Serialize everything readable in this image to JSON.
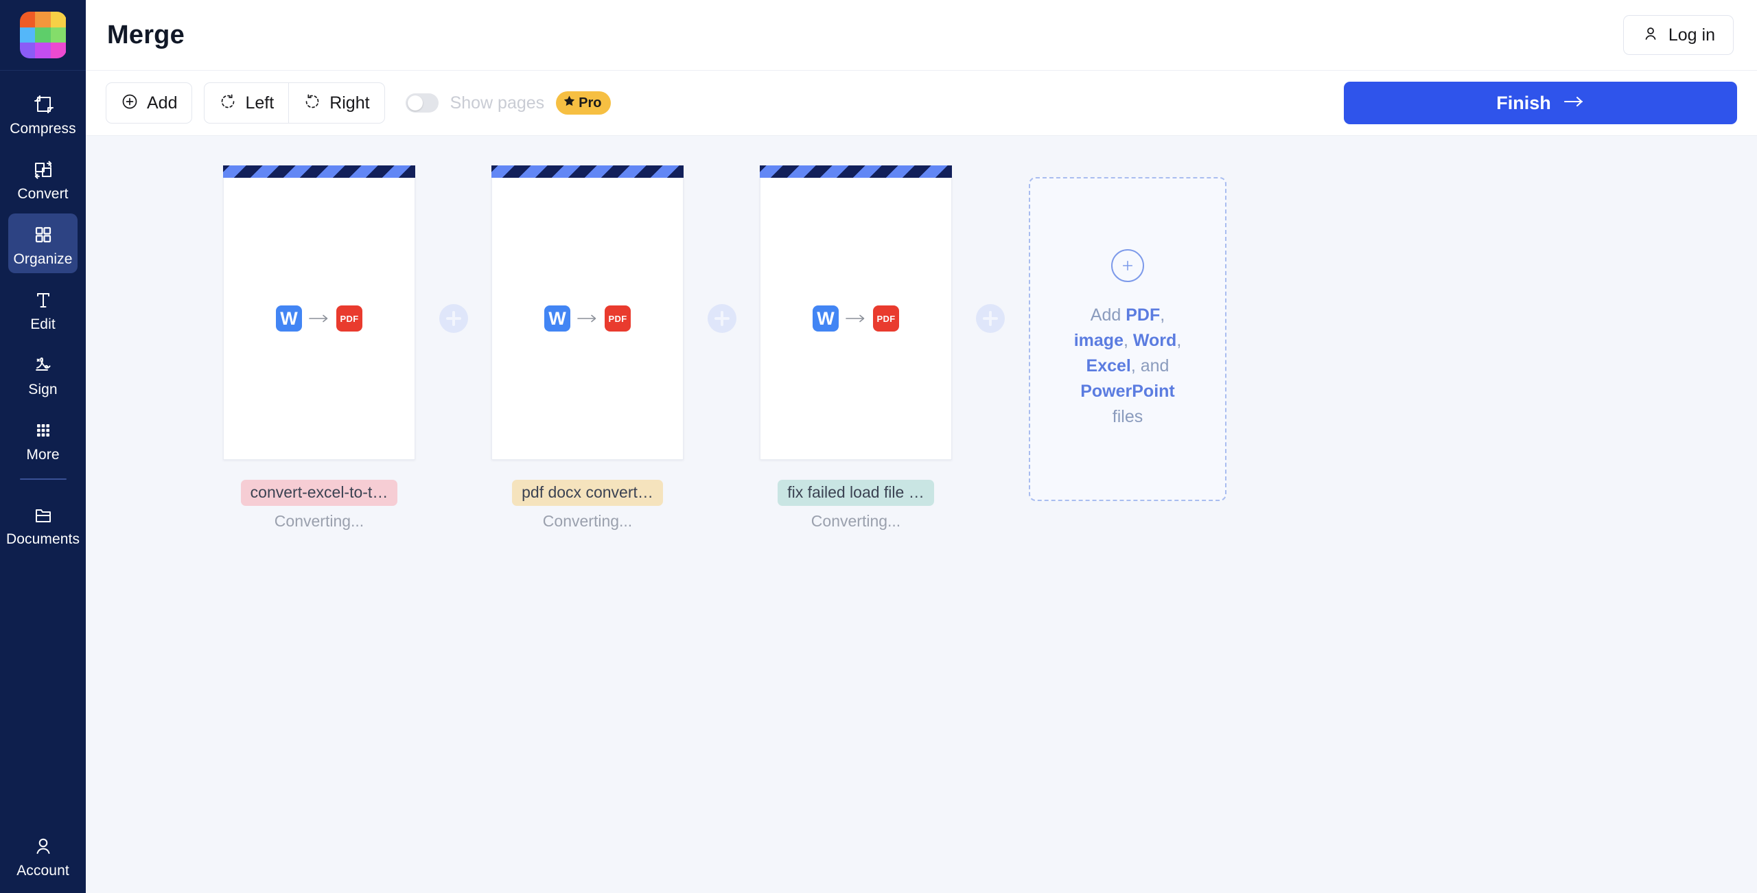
{
  "app": {
    "logo_colors": [
      "#ef5b25",
      "#f2973c",
      "#f7d046",
      "#54b7f9",
      "#5ece6a",
      "#84dd6a",
      "#8b5cf6",
      "#c44df0",
      "#ec4ad0"
    ],
    "background": "#f4f6fb"
  },
  "sidebar": {
    "logo_name": "app-logo",
    "items": [
      {
        "label": "Compress",
        "icon": "compress-icon",
        "active": false
      },
      {
        "label": "Convert",
        "icon": "convert-icon",
        "active": false
      },
      {
        "label": "Organize",
        "icon": "organize-icon",
        "active": true
      },
      {
        "label": "Edit",
        "icon": "edit-text-icon",
        "active": false
      },
      {
        "label": "Sign",
        "icon": "signature-icon",
        "active": false
      },
      {
        "label": "More",
        "icon": "grid-dots-icon",
        "active": false
      },
      {
        "label": "Documents",
        "icon": "folder-icon",
        "active": false
      }
    ],
    "account": {
      "label": "Account",
      "icon": "user-icon"
    },
    "active_color": "#2d4383",
    "background": "#0e1f4d"
  },
  "header": {
    "title": "Merge",
    "login": {
      "label": "Log in",
      "icon": "user-icon"
    }
  },
  "toolbar": {
    "add": {
      "label": "Add",
      "icon": "plus-circle-icon"
    },
    "rotate_left": {
      "label": "Left",
      "icon": "rotate-left-icon"
    },
    "rotate_right": {
      "label": "Right",
      "icon": "rotate-right-icon"
    },
    "show_pages": {
      "label": "Show pages",
      "enabled": false
    },
    "pro_badge": {
      "label": "Pro",
      "icon": "star-icon",
      "color": "#f6bf42"
    },
    "finish": {
      "label": "Finish",
      "icon": "arrow-right-icon",
      "color": "#2f54eb"
    }
  },
  "files": [
    {
      "name": "convert-excel-to-t…",
      "status": "Converting...",
      "chip_color": "#f6cdd4",
      "from_format": "W",
      "to_format": "PDF",
      "progress_state": "indeterminate"
    },
    {
      "name": "pdf docx convert…",
      "status": "Converting...",
      "chip_color": "#f5e3bd",
      "from_format": "W",
      "to_format": "PDF",
      "progress_state": "indeterminate"
    },
    {
      "name": "fix failed load file …",
      "status": "Converting...",
      "chip_color": "#c9e5e3",
      "from_format": "W",
      "to_format": "PDF",
      "progress_state": "indeterminate"
    }
  ],
  "dropzone": {
    "icon": "plus-circle-icon",
    "line1_pre": "Add ",
    "line1_bold": "PDF",
    "line1_post": ",",
    "line2_b1": "image",
    "line2_sep1": ", ",
    "line2_b2": "Word",
    "line2_post": ",",
    "line3_b1": "Excel",
    "line3_post": ", and",
    "line4_bold": "PowerPoint",
    "line5": "files"
  }
}
